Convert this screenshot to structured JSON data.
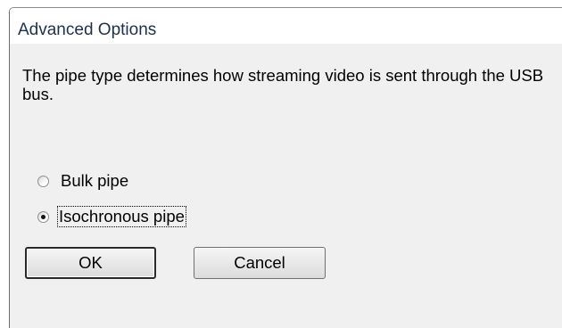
{
  "window": {
    "title": "Advanced Options"
  },
  "description": "The pipe type determines how streaming video is sent through the USB bus.",
  "pipe_options": [
    {
      "label": "Bulk pipe",
      "selected": false
    },
    {
      "label": "Isochronous pipe",
      "selected": true
    }
  ],
  "buttons": {
    "ok_label": "OK",
    "cancel_label": "Cancel"
  }
}
